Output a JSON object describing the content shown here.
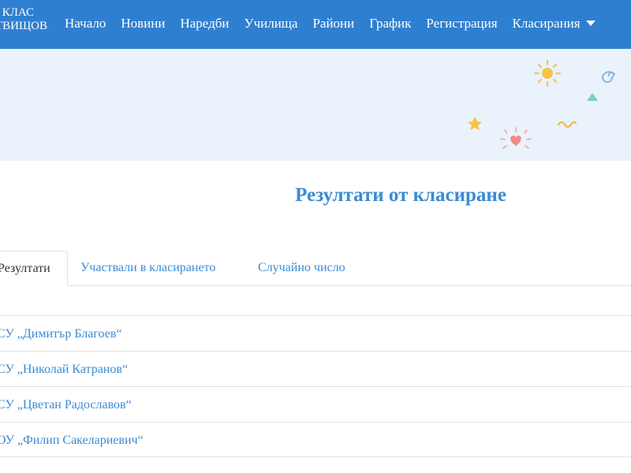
{
  "navbar": {
    "brand_line1": "I КЛАС",
    "brand_line2": "ТВИЩОВ",
    "items": [
      {
        "label": "Начало"
      },
      {
        "label": "Новини"
      },
      {
        "label": "Наредби"
      },
      {
        "label": "Училища"
      },
      {
        "label": "Райони"
      },
      {
        "label": "График"
      },
      {
        "label": "Регистрация"
      },
      {
        "label": "Класирания"
      }
    ],
    "dropdown_icon": "caret-down-icon",
    "bg_color": "#2f7fd0"
  },
  "hero": {
    "bg_color": "#eaf2fc",
    "decorations": [
      "sun-icon",
      "spiral-icon",
      "triangle-icon",
      "star-icon",
      "squiggle-icon",
      "heart-icon"
    ]
  },
  "main": {
    "title": "Резултати от класиране",
    "tabs": [
      {
        "label": "Резултати",
        "active": true
      },
      {
        "label": "Участвали в класирането",
        "active": false
      },
      {
        "label": "Случайно число",
        "active": false
      }
    ],
    "results": [
      {
        "label": "СУ „Димитър Благоев“"
      },
      {
        "label": "СУ „Николай Катранов“"
      },
      {
        "label": "СУ „Цветан Радославов“"
      },
      {
        "label": "ОУ „Филип Сакелариевич“"
      }
    ],
    "accent_color": "#3a8bd3"
  }
}
